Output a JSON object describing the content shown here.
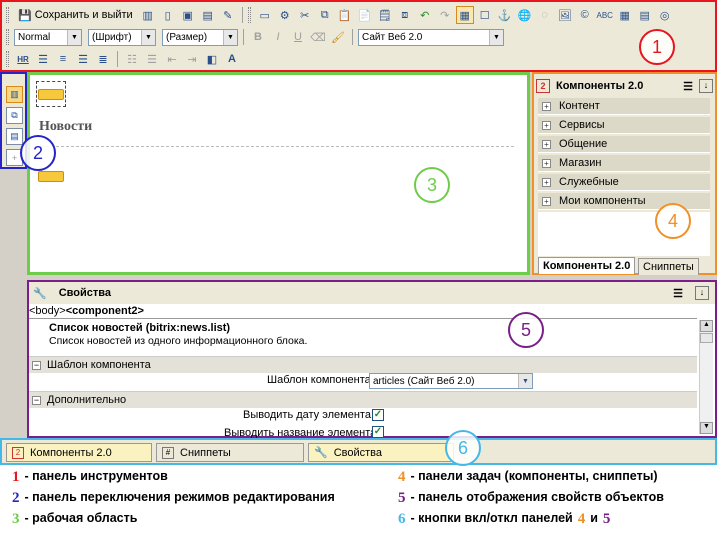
{
  "toolbar": {
    "save_label": "Сохранить и выйти",
    "style_select": "Normal",
    "font_select": "(Шрифт)",
    "size_select": "(Размер)",
    "template_select": "Сайт Веб 2.0",
    "bold": "B",
    "italic": "I",
    "underline": "U",
    "hr": "HR"
  },
  "workarea": {
    "heading": "Новости"
  },
  "components_panel": {
    "title": "Компоненты 2.0",
    "groups": [
      "Контент",
      "Сервисы",
      "Общение",
      "Магазин",
      "Служебные",
      "Мои компоненты"
    ],
    "tabs": [
      "Компоненты 2.0",
      "Сниппеты"
    ]
  },
  "properties_panel": {
    "title": "Свойства",
    "path_body": "<body>",
    "path_component": "<component2>",
    "component_name": "Список новостей (bitrix:news.list)",
    "component_desc": "Список новостей из одного информационного блока.",
    "section_template": "Шаблон компонента",
    "template_label": "Шаблон компонента:",
    "template_value": "articles (Сайт Веб 2.0)",
    "section_extra": "Дополнительно",
    "option_date": "Выводить дату элемента:",
    "option_name": "Выводить название элемента:",
    "option_date_checked": true,
    "option_name_checked": true
  },
  "bottom_buttons": [
    "Компоненты 2.0",
    "Сниппеты",
    "Свойства"
  ],
  "markers": [
    "1",
    "2",
    "3",
    "4",
    "5",
    "6"
  ],
  "legend": [
    {
      "num": "1",
      "text": "- панель инструментов",
      "color": "#e8141e"
    },
    {
      "num": "2",
      "text": "- панель переключения режимов редактирования",
      "color": "#2424c8"
    },
    {
      "num": "3",
      "text": "- рабочая область",
      "color": "#6fcc4a"
    },
    {
      "num": "4",
      "text": "- панели задач (компоненты, сниппеты)",
      "color": "#f09028"
    },
    {
      "num": "5",
      "text": "- панель отображения свойств объектов",
      "color": "#7a1f8a"
    },
    {
      "num": "6",
      "text": "- кнопки вкл/откл панелей",
      "color": "#45b8e8"
    }
  ],
  "legend_suffix": {
    "a": "4",
    "and": "и",
    "b": "5"
  },
  "colors": {
    "red": "#e8141e",
    "blue": "#2424c8",
    "green": "#6fcc4a",
    "orange": "#f09028",
    "purple": "#7a1f8a",
    "cyan": "#45b8e8"
  }
}
